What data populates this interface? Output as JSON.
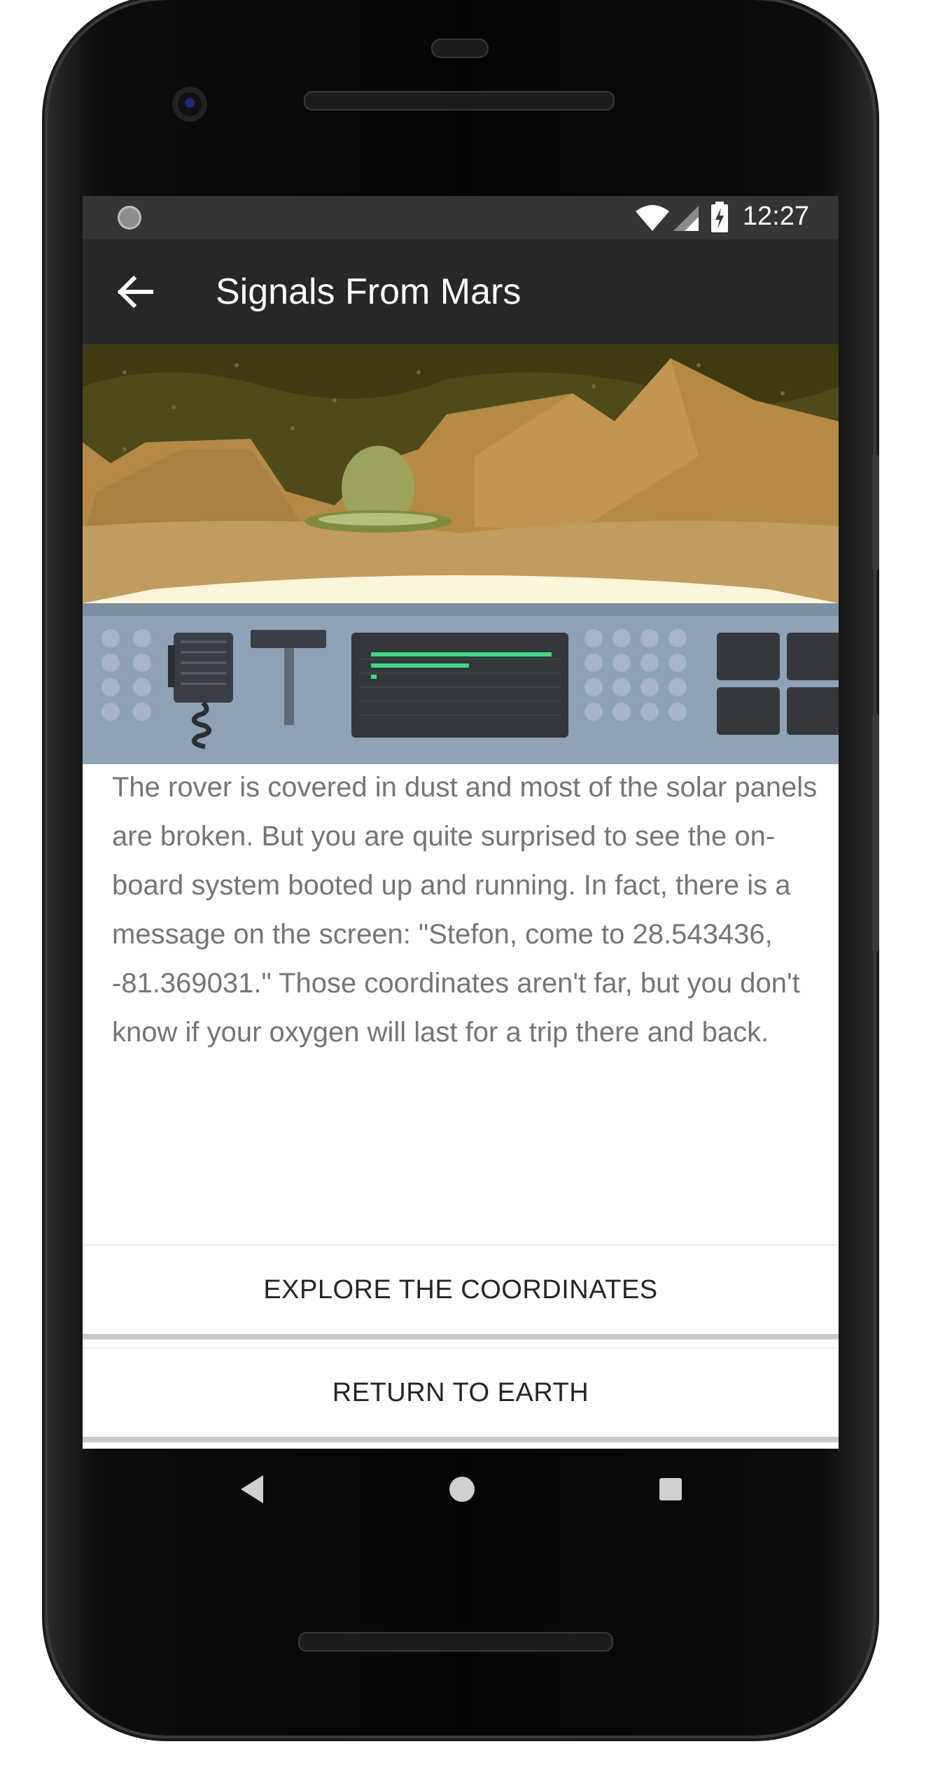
{
  "status_bar": {
    "time": "12:27"
  },
  "app_bar": {
    "title": "Signals From Mars",
    "back_icon": "arrow-back-icon"
  },
  "story": {
    "text": "The rover is covered in dust and most of the solar panels are broken. But you are quite surprised to see the on-board system booted up and running. In fact, there is a message on the screen: \"Stefon, come to 28.543436, -81.369031.\" Those coordinates aren't far, but you don't know if your oxygen will last for a trip there and back."
  },
  "buttons": {
    "explore": "EXPLORE THE COORDINATES",
    "return": "RETURN TO EARTH"
  },
  "nav": {
    "back": "nav-back-icon",
    "home": "nav-home-icon",
    "recents": "nav-recents-icon"
  },
  "colors": {
    "status_bar": "#333537",
    "app_bar": "#262728",
    "text": "#757575",
    "accent_green": "#3ddc84"
  }
}
